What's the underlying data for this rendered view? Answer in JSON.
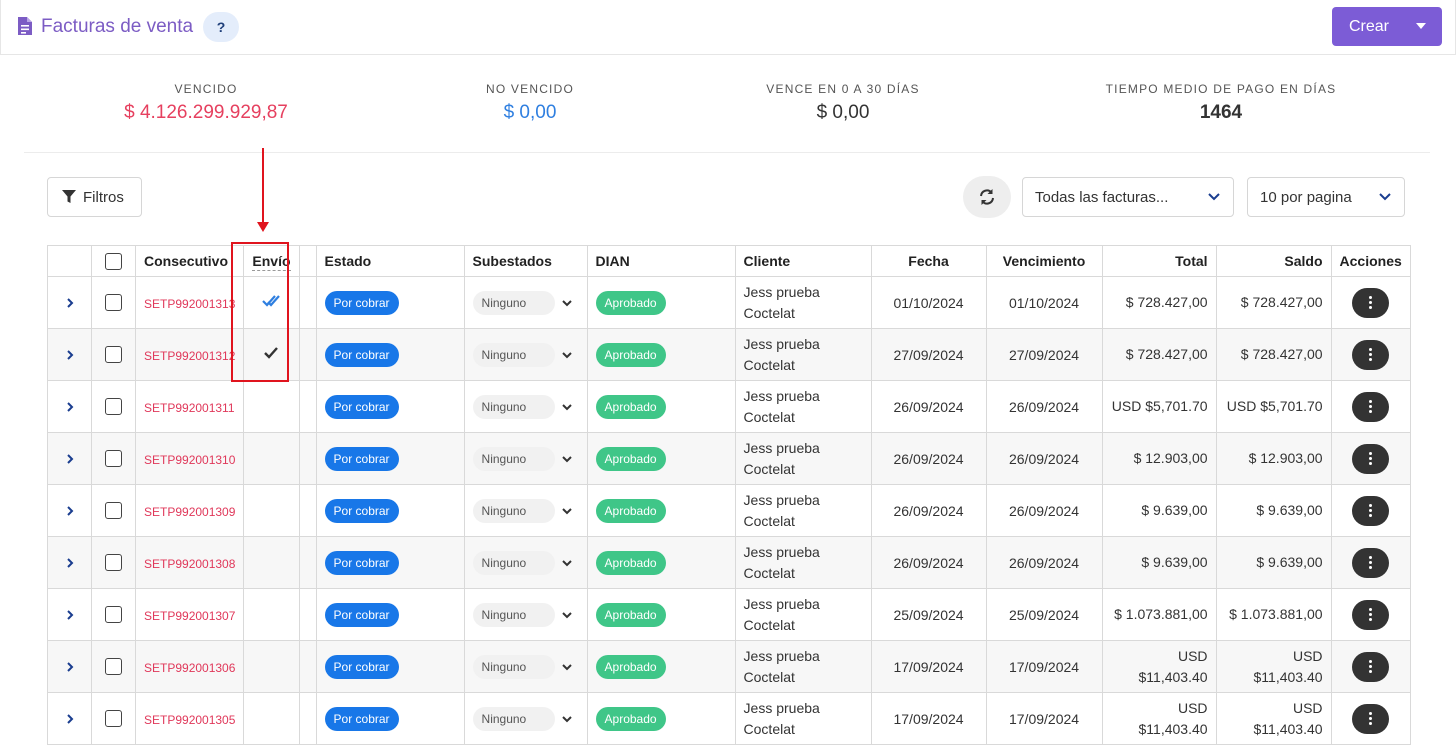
{
  "header": {
    "title": "Facturas de venta",
    "help_label": "?",
    "create_label": "Crear"
  },
  "kpis": [
    {
      "label": "VENCIDO",
      "value": "$ 4.126.299.929,87",
      "color": "#e6405f"
    },
    {
      "label": "NO VENCIDO",
      "value": "$ 0,00",
      "color": "#2f7fe0"
    },
    {
      "label": "VENCE EN 0 A 30 DÍAS",
      "value": "$ 0,00",
      "color": "#333333"
    },
    {
      "label": "TIEMPO MEDIO DE PAGO EN DÍAS",
      "value": "1464",
      "color": "#333333"
    }
  ],
  "toolbar": {
    "filters_label": "Filtros",
    "invoice_filter_value": "Todas las facturas...",
    "page_size_value": "10 por pagina"
  },
  "table": {
    "headers": {
      "consecutivo": "Consecutivo",
      "envio": "Envío",
      "estado": "Estado",
      "subestados": "Subestados",
      "dian": "DIAN",
      "cliente": "Cliente",
      "fecha": "Fecha",
      "vencimiento": "Vencimiento",
      "total": "Total",
      "saldo": "Saldo",
      "acciones": "Acciones"
    },
    "rows": [
      {
        "consecutivo": "SETP992001313",
        "envio": "double-check",
        "estado": "Por cobrar",
        "subestado": "Ninguno",
        "dian": "Aprobado",
        "cliente_1": "Jess prueba",
        "cliente_2": "Coctelat",
        "fecha": "01/10/2024",
        "vencimiento": "01/10/2024",
        "total": "$ 728.427,00",
        "total_2": "",
        "saldo": "$ 728.427,00",
        "saldo_2": ""
      },
      {
        "consecutivo": "SETP992001312",
        "envio": "check",
        "estado": "Por cobrar",
        "subestado": "Ninguno",
        "dian": "Aprobado",
        "cliente_1": "Jess prueba",
        "cliente_2": "Coctelat",
        "fecha": "27/09/2024",
        "vencimiento": "27/09/2024",
        "total": "$ 728.427,00",
        "total_2": "",
        "saldo": "$ 728.427,00",
        "saldo_2": ""
      },
      {
        "consecutivo": "SETP992001311",
        "envio": "",
        "estado": "Por cobrar",
        "subestado": "Ninguno",
        "dian": "Aprobado",
        "cliente_1": "Jess prueba",
        "cliente_2": "Coctelat",
        "fecha": "26/09/2024",
        "vencimiento": "26/09/2024",
        "total": "USD $5,701.70",
        "total_2": "",
        "saldo": "USD $5,701.70",
        "saldo_2": ""
      },
      {
        "consecutivo": "SETP992001310",
        "envio": "",
        "estado": "Por cobrar",
        "subestado": "Ninguno",
        "dian": "Aprobado",
        "cliente_1": "Jess prueba",
        "cliente_2": "Coctelat",
        "fecha": "26/09/2024",
        "vencimiento": "26/09/2024",
        "total": "$ 12.903,00",
        "total_2": "",
        "saldo": "$ 12.903,00",
        "saldo_2": ""
      },
      {
        "consecutivo": "SETP992001309",
        "envio": "",
        "estado": "Por cobrar",
        "subestado": "Ninguno",
        "dian": "Aprobado",
        "cliente_1": "Jess prueba",
        "cliente_2": "Coctelat",
        "fecha": "26/09/2024",
        "vencimiento": "26/09/2024",
        "total": "$ 9.639,00",
        "total_2": "",
        "saldo": "$ 9.639,00",
        "saldo_2": ""
      },
      {
        "consecutivo": "SETP992001308",
        "envio": "",
        "estado": "Por cobrar",
        "subestado": "Ninguno",
        "dian": "Aprobado",
        "cliente_1": "Jess prueba",
        "cliente_2": "Coctelat",
        "fecha": "26/09/2024",
        "vencimiento": "26/09/2024",
        "total": "$ 9.639,00",
        "total_2": "",
        "saldo": "$ 9.639,00",
        "saldo_2": ""
      },
      {
        "consecutivo": "SETP992001307",
        "envio": "",
        "estado": "Por cobrar",
        "subestado": "Ninguno",
        "dian": "Aprobado",
        "cliente_1": "Jess prueba",
        "cliente_2": "Coctelat",
        "fecha": "25/09/2024",
        "vencimiento": "25/09/2024",
        "total": "$ 1.073.881,00",
        "total_2": "",
        "saldo": "$ 1.073.881,00",
        "saldo_2": ""
      },
      {
        "consecutivo": "SETP992001306",
        "envio": "",
        "estado": "Por cobrar",
        "subestado": "Ninguno",
        "dian": "Aprobado",
        "cliente_1": "Jess prueba",
        "cliente_2": "Coctelat",
        "fecha": "17/09/2024",
        "vencimiento": "17/09/2024",
        "total": "USD",
        "total_2": "$11,403.40",
        "saldo": "USD",
        "saldo_2": "$11,403.40"
      },
      {
        "consecutivo": "SETP992001305",
        "envio": "",
        "estado": "Por cobrar",
        "subestado": "Ninguno",
        "dian": "Aprobado",
        "cliente_1": "Jess prueba",
        "cliente_2": "Coctelat",
        "fecha": "17/09/2024",
        "vencimiento": "17/09/2024",
        "total": "USD",
        "total_2": "$11,403.40",
        "saldo": "USD",
        "saldo_2": "$11,403.40"
      }
    ]
  },
  "colors": {
    "brand": "#7c5cd6",
    "danger": "#e6405f",
    "status_blue": "#1877e8",
    "status_green": "#3fc688",
    "annotation": "#e0141e"
  }
}
